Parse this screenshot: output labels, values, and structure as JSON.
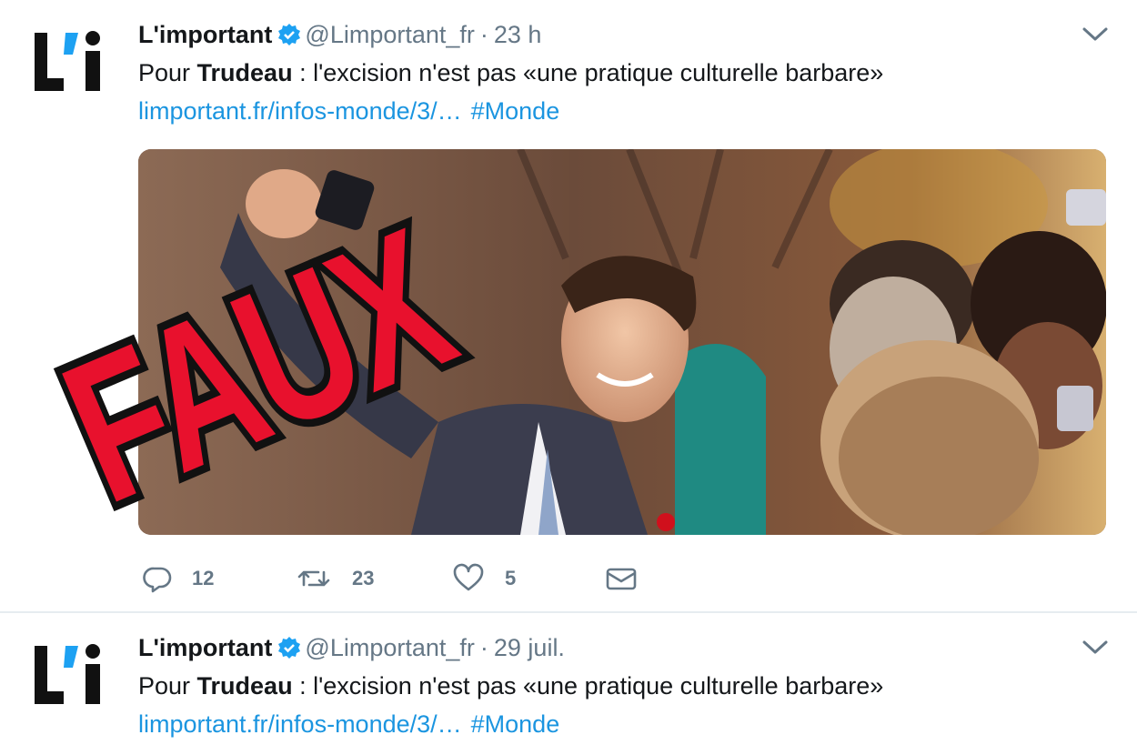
{
  "tweets": [
    {
      "name": "L'important",
      "handle": "@Limportant_fr",
      "separator": "·",
      "time": "23 h",
      "text_pre": "Pour ",
      "text_bold": "Trudeau",
      "text_post": " : l'excision n'est pas «une pratique culturelle barbare»",
      "link": "limportant.fr/infos-monde/3/…",
      "hashtag": "#Monde",
      "avatar_text": "L'i",
      "stamp_text": "FAUX",
      "actions": {
        "replies": "12",
        "retweets": "23",
        "likes": "5"
      }
    },
    {
      "name": "L'important",
      "handle": "@Limportant_fr",
      "separator": "·",
      "time": "29 juil.",
      "text_pre": "Pour ",
      "text_bold": "Trudeau",
      "text_post": " : l'excision n'est pas «une pratique culturelle barbare»",
      "link": "limportant.fr/infos-monde/3/…",
      "hashtag": "#Monde",
      "avatar_text": "L'i"
    }
  ],
  "icons": {
    "verified": "verified-badge-icon",
    "chevron": "chevron-down-icon",
    "reply": "reply-icon",
    "retweet": "retweet-icon",
    "like": "heart-icon",
    "dm": "envelope-icon"
  },
  "colors": {
    "link": "#1b95e0",
    "secondary": "#657786",
    "verified": "#1da1f2",
    "stamp_red": "#e8112d",
    "avatar_accent": "#1da1f2"
  }
}
